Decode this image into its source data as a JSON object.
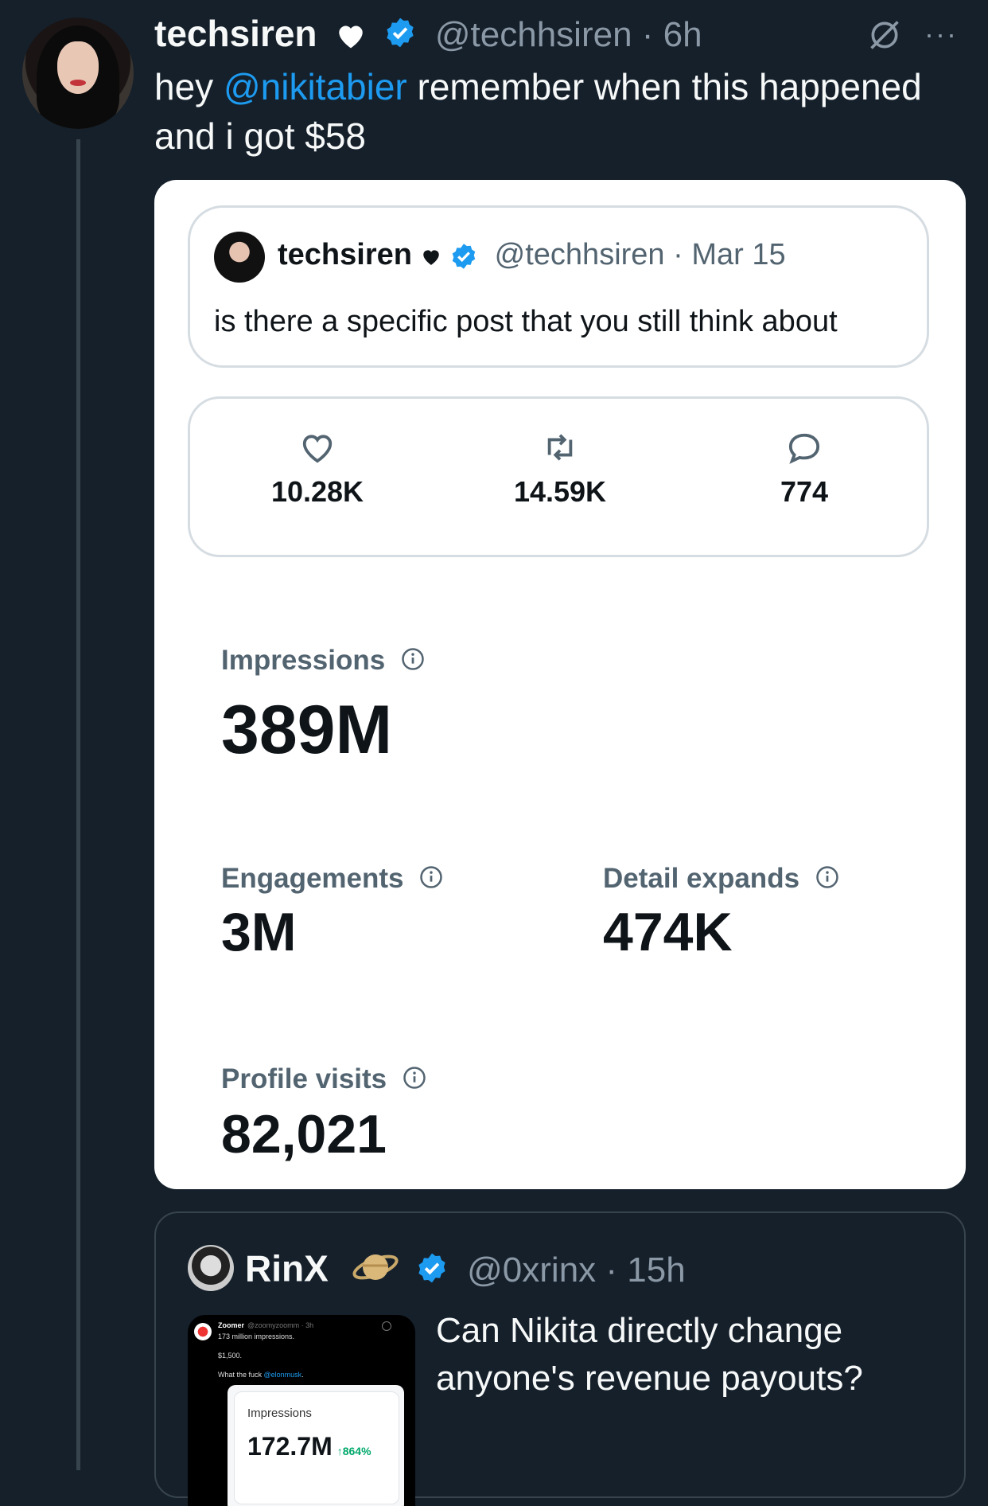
{
  "tweet": {
    "author_name": "techsiren",
    "handle": "@techhsiren",
    "time": "6h",
    "text_prefix": "hey ",
    "mention": "@nikitabier",
    "text_suffix": " remember when this happened and i got $58",
    "more": "···"
  },
  "media": {
    "quoted": {
      "author_name": "techsiren",
      "handle": "@techhsiren",
      "date": "Mar 15",
      "text": "is there a specific post that you still think about"
    },
    "stats": {
      "likes": "10.28K",
      "reposts": "14.59K",
      "replies": "774"
    },
    "metrics": {
      "impressions_label": "Impressions",
      "impressions_value": "389M",
      "engagements_label": "Engagements",
      "engagements_value": "3M",
      "detail_expands_label": "Detail expands",
      "detail_expands_value": "474K",
      "profile_visits_label": "Profile visits",
      "profile_visits_value": "82,021"
    }
  },
  "quote": {
    "author_name": "RinX",
    "handle": "@0xrinx",
    "time": "15h",
    "text": "Can Nikita directly change anyone's revenue payouts?",
    "thumbnail": {
      "name": "Zoomer",
      "handle": "@zoomyzoomm · 3h",
      "line1": "173 million impressions.",
      "line2": "$1,500.",
      "line3_prefix": "What the fuck ",
      "line3_mention": "@elonmusk",
      "line3_suffix": ".",
      "impressions_label": "Impressions",
      "impressions_value": "172.7M",
      "impressions_change": "↑864%"
    }
  },
  "colors": {
    "background": "#15202b",
    "accent": "#1d9bf0",
    "muted": "#8b98a5"
  }
}
